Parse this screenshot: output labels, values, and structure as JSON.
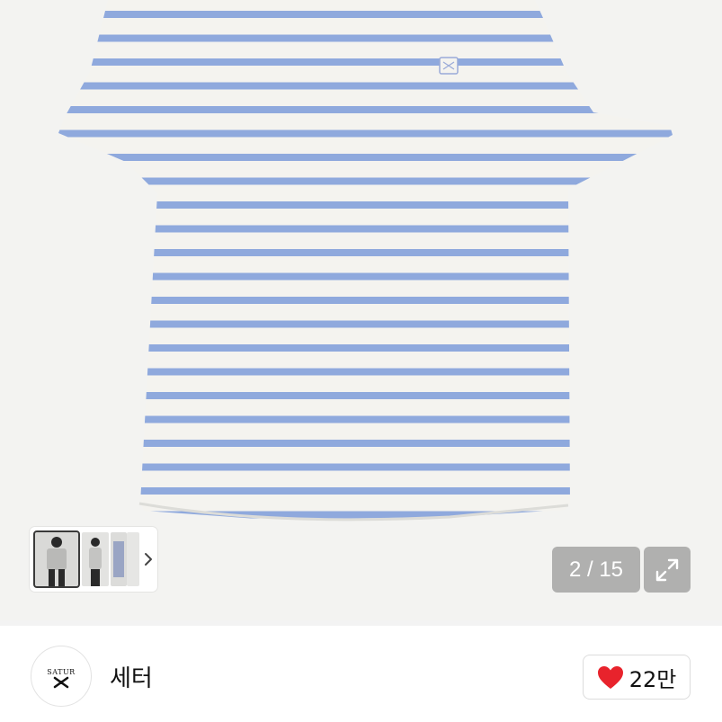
{
  "gallery": {
    "counter_text": "2 / 15",
    "thumbnails": [
      {
        "name": "thumbnail-model-front",
        "selected": true
      },
      {
        "name": "thumbnail-model-side",
        "selected": false
      },
      {
        "name": "thumbnail-3",
        "selected": false
      },
      {
        "name": "thumbnail-4",
        "selected": false
      }
    ],
    "next_icon": "chevron-right-icon",
    "expand_icon": "expand-arrows-icon"
  },
  "shop": {
    "avatar_text": "SATUR",
    "name": "세터"
  },
  "like": {
    "icon": "heart-icon",
    "count": "22만",
    "heart_color": "#e8232c"
  },
  "colors": {
    "stripe_blue": "#8fa9dd",
    "shirt_white": "#f4f3ef"
  }
}
